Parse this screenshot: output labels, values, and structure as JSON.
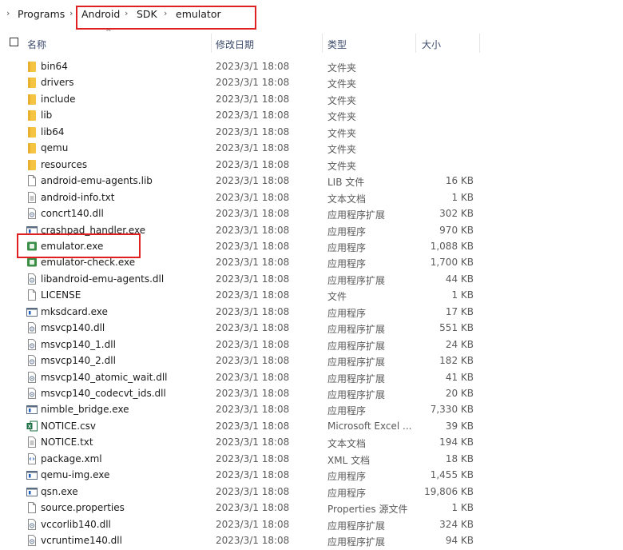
{
  "breadcrumb": {
    "lead_chevron": "›",
    "items": [
      "Programs",
      "Android",
      "SDK",
      "emulator"
    ],
    "separator": "›"
  },
  "columns": {
    "name": "名称",
    "date": "修改日期",
    "type": "类型",
    "size": "大小"
  },
  "files": [
    {
      "name": "bin64",
      "date": "2023/3/1 18:08",
      "type": "文件夹",
      "size": "",
      "icon": "folder-icon"
    },
    {
      "name": "drivers",
      "date": "2023/3/1 18:08",
      "type": "文件夹",
      "size": "",
      "icon": "folder-icon"
    },
    {
      "name": "include",
      "date": "2023/3/1 18:08",
      "type": "文件夹",
      "size": "",
      "icon": "folder-icon"
    },
    {
      "name": "lib",
      "date": "2023/3/1 18:08",
      "type": "文件夹",
      "size": "",
      "icon": "folder-icon"
    },
    {
      "name": "lib64",
      "date": "2023/3/1 18:08",
      "type": "文件夹",
      "size": "",
      "icon": "folder-icon"
    },
    {
      "name": "qemu",
      "date": "2023/3/1 18:08",
      "type": "文件夹",
      "size": "",
      "icon": "folder-icon"
    },
    {
      "name": "resources",
      "date": "2023/3/1 18:08",
      "type": "文件夹",
      "size": "",
      "icon": "folder-icon"
    },
    {
      "name": "android-emu-agents.lib",
      "date": "2023/3/1 18:08",
      "type": "LIB 文件",
      "size": "16 KB",
      "icon": "file-icon"
    },
    {
      "name": "android-info.txt",
      "date": "2023/3/1 18:08",
      "type": "文本文档",
      "size": "1 KB",
      "icon": "text-file-icon"
    },
    {
      "name": "concrt140.dll",
      "date": "2023/3/1 18:08",
      "type": "应用程序扩展",
      "size": "302 KB",
      "icon": "dll-icon"
    },
    {
      "name": "crashpad_handler.exe",
      "date": "2023/3/1 18:08",
      "type": "应用程序",
      "size": "970 KB",
      "icon": "exe-icon"
    },
    {
      "name": "emulator.exe",
      "date": "2023/3/1 18:08",
      "type": "应用程序",
      "size": "1,088 KB",
      "icon": "android-exe-icon"
    },
    {
      "name": "emulator-check.exe",
      "date": "2023/3/1 18:08",
      "type": "应用程序",
      "size": "1,700 KB",
      "icon": "android-exe-icon"
    },
    {
      "name": "libandroid-emu-agents.dll",
      "date": "2023/3/1 18:08",
      "type": "应用程序扩展",
      "size": "44 KB",
      "icon": "dll-icon"
    },
    {
      "name": "LICENSE",
      "date": "2023/3/1 18:08",
      "type": "文件",
      "size": "1 KB",
      "icon": "file-icon"
    },
    {
      "name": "mksdcard.exe",
      "date": "2023/3/1 18:08",
      "type": "应用程序",
      "size": "17 KB",
      "icon": "exe-icon"
    },
    {
      "name": "msvcp140.dll",
      "date": "2023/3/1 18:08",
      "type": "应用程序扩展",
      "size": "551 KB",
      "icon": "dll-icon"
    },
    {
      "name": "msvcp140_1.dll",
      "date": "2023/3/1 18:08",
      "type": "应用程序扩展",
      "size": "24 KB",
      "icon": "dll-icon"
    },
    {
      "name": "msvcp140_2.dll",
      "date": "2023/3/1 18:08",
      "type": "应用程序扩展",
      "size": "182 KB",
      "icon": "dll-icon"
    },
    {
      "name": "msvcp140_atomic_wait.dll",
      "date": "2023/3/1 18:08",
      "type": "应用程序扩展",
      "size": "41 KB",
      "icon": "dll-icon"
    },
    {
      "name": "msvcp140_codecvt_ids.dll",
      "date": "2023/3/1 18:08",
      "type": "应用程序扩展",
      "size": "20 KB",
      "icon": "dll-icon"
    },
    {
      "name": "nimble_bridge.exe",
      "date": "2023/3/1 18:08",
      "type": "应用程序",
      "size": "7,330 KB",
      "icon": "exe-icon"
    },
    {
      "name": "NOTICE.csv",
      "date": "2023/3/1 18:08",
      "type": "Microsoft Excel ...",
      "size": "39 KB",
      "icon": "excel-icon"
    },
    {
      "name": "NOTICE.txt",
      "date": "2023/3/1 18:08",
      "type": "文本文档",
      "size": "194 KB",
      "icon": "text-file-icon"
    },
    {
      "name": "package.xml",
      "date": "2023/3/1 18:08",
      "type": "XML 文档",
      "size": "18 KB",
      "icon": "xml-icon"
    },
    {
      "name": "qemu-img.exe",
      "date": "2023/3/1 18:08",
      "type": "应用程序",
      "size": "1,455 KB",
      "icon": "exe-icon"
    },
    {
      "name": "qsn.exe",
      "date": "2023/3/1 18:08",
      "type": "应用程序",
      "size": "19,806 KB",
      "icon": "exe-icon"
    },
    {
      "name": "source.properties",
      "date": "2023/3/1 18:08",
      "type": "Properties 源文件",
      "size": "1 KB",
      "icon": "file-icon"
    },
    {
      "name": "vccorlib140.dll",
      "date": "2023/3/1 18:08",
      "type": "应用程序扩展",
      "size": "324 KB",
      "icon": "dll-icon"
    },
    {
      "name": "vcruntime140.dll",
      "date": "2023/3/1 18:08",
      "type": "应用程序扩展",
      "size": "94 KB",
      "icon": "dll-icon"
    }
  ],
  "colors": {
    "highlight_box": "#e02020",
    "folder": "#f4c542",
    "exe_blue": "#1f5fbf",
    "android_green": "#3ddc84"
  }
}
